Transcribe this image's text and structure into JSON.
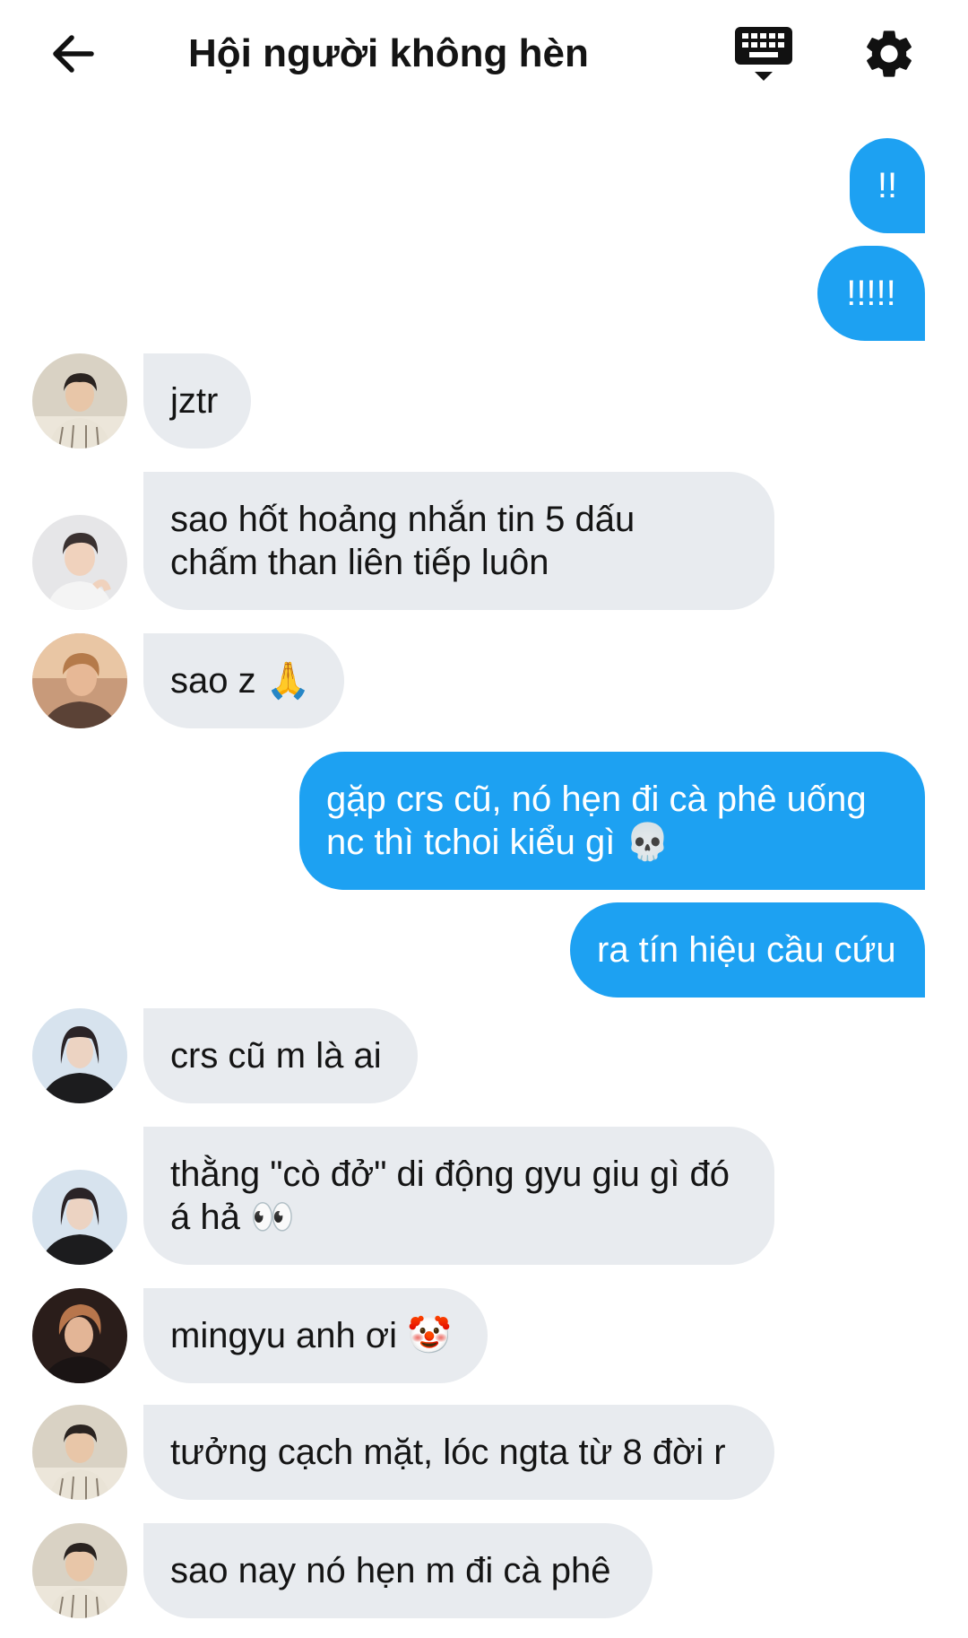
{
  "header": {
    "title": "Hội người không hèn",
    "back_icon": "arrow-left-icon",
    "keyboard_icon": "keyboard-icon",
    "settings_icon": "gear-icon"
  },
  "colors": {
    "outgoing_bubble": "#1da1f2",
    "incoming_bubble": "#e8ebef",
    "text_dark": "#141414"
  },
  "messages": [
    {
      "direction": "out",
      "text": "!!"
    },
    {
      "direction": "out",
      "text": "!!!!!"
    },
    {
      "direction": "in",
      "text": "jztr"
    },
    {
      "direction": "in",
      "text": "sao hốt hoảng nhắn tin 5 dấu\nchấm than liên tiếp luôn"
    },
    {
      "direction": "in",
      "text": "sao z 🙏"
    },
    {
      "direction": "out",
      "text": "gặp crs cũ, nó hẹn đi cà phê uống\nnc thì tchoi kiểu gì 💀"
    },
    {
      "direction": "out",
      "text": "ra tín hiệu cầu cứu"
    },
    {
      "direction": "in",
      "text": "crs cũ m là ai"
    },
    {
      "direction": "in",
      "text": "thằng \"cò đở\" di động gyu giu gì đó\ná hả 👀"
    },
    {
      "direction": "in",
      "text": "mingyu anh ơi 🤡"
    },
    {
      "direction": "in",
      "text": "tưởng cạch mặt, lóc ngta từ 8 đời r"
    },
    {
      "direction": "in",
      "text": "sao nay nó hẹn m đi cà phê"
    }
  ]
}
